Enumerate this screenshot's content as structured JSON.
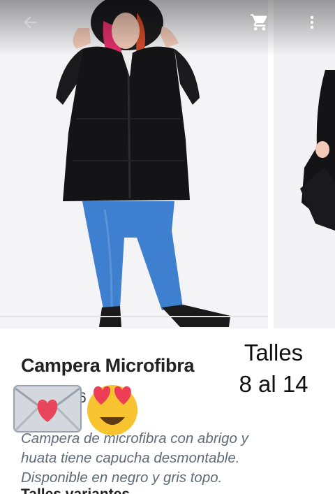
{
  "toolbar": {
    "back_icon": "arrow-back-icon",
    "cart_icon": "shopping-cart-icon",
    "menu_icon": "more-vert-icon"
  },
  "product": {
    "title": "Campera Microfibra",
    "price_fragment": "6",
    "sizes_line1": "Talles",
    "sizes_line2": "8 al 14",
    "description_lines": [
      "Campera de microfibra con abrigo y",
      "huata tiene capucha desmontable.",
      "Disponible en negro y gris topo."
    ],
    "description_cut": "Talles variantes"
  },
  "emojis": {
    "envelope": "love-letter-icon",
    "face": "heart-eyes-face-icon"
  },
  "colors": {
    "jacket": "#141416",
    "jeans": "#3f7fd0",
    "hair": "#e5306b",
    "description_text": "#5f6b78",
    "title_text": "#222222"
  }
}
